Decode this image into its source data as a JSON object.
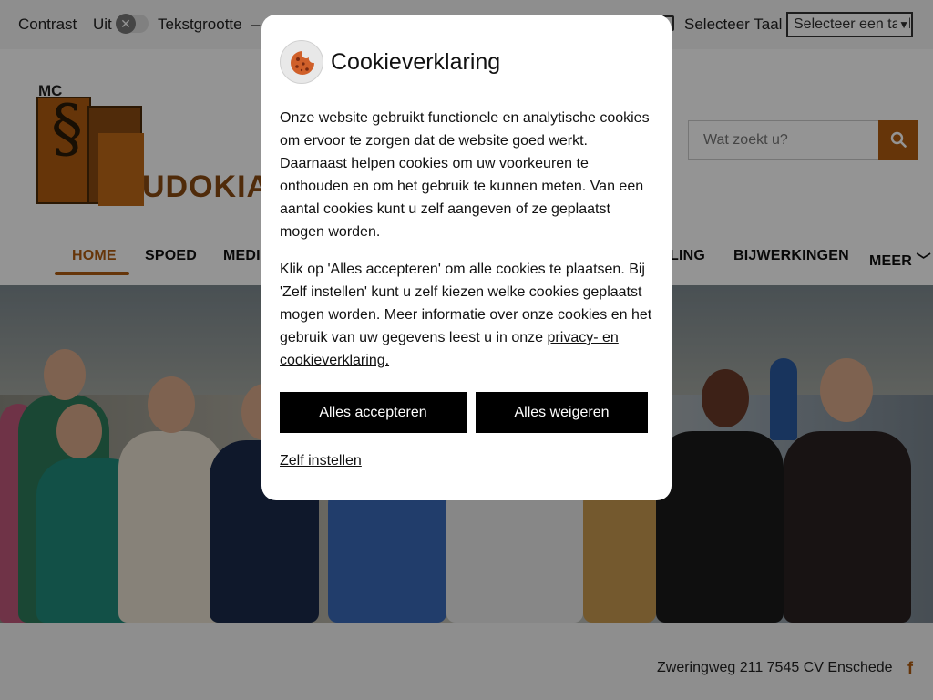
{
  "topbar": {
    "contrast_label": "Contrast",
    "contrast_state": "Uit",
    "toggle_symbol": "✕",
    "textsize_label": "Tekstgrootte",
    "textsize_decrease": "–",
    "language_label": "Selecteer Taal",
    "language_select": "Selecteer een taal"
  },
  "header": {
    "logo_prefix": "MC",
    "logo_text": "UDOKIA",
    "search_placeholder": "Wat zoekt u?"
  },
  "nav": {
    "items": [
      {
        "label": "HOME",
        "active": true
      },
      {
        "label": "SPOED"
      },
      {
        "label": "MEDIS"
      },
      {
        "label": "LING"
      },
      {
        "label": "BIJWERKINGEN"
      },
      {
        "label": "MEER ﹀"
      }
    ]
  },
  "footer": {
    "address": "Zweringweg 211 7545 CV  Enschede",
    "social_icon": "f"
  },
  "modal": {
    "title": "Cookieverklaring",
    "paragraph1": "Onze website gebruikt functionele en analytische cookies om ervoor te zorgen dat de website goed werkt. Daarnaast helpen cookies om uw voorkeuren te onthouden en om het gebruik te kunnen meten. Van een aantal cookies kunt u zelf aangeven of ze geplaatst mogen worden.",
    "paragraph2_text": "Klik op 'Alles accepteren' om alle cookies te plaatsen. Bij 'Zelf instellen' kunt u zelf kiezen welke cookies geplaatst mogen worden. Meer informatie over onze cookies en het gebruik van uw gegevens leest u in onze ",
    "paragraph2_link": "privacy- en cookieverklaring.",
    "accept_label": "Alles accepteren",
    "reject_label": "Alles weigeren",
    "settings_label": "Zelf instellen"
  },
  "colors": {
    "accent": "#b05c10",
    "button_bg": "#000000",
    "overlay": "rgba(0,0,0,0.42)"
  }
}
